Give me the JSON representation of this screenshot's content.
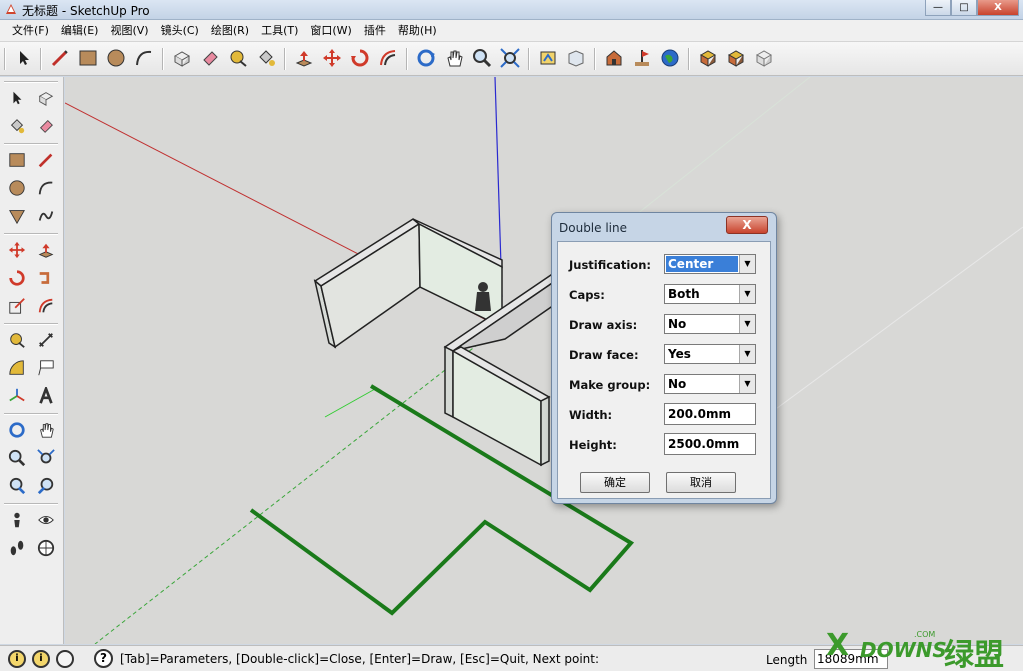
{
  "window": {
    "title": "无标题 - SketchUp Pro",
    "minimize": "—",
    "maximize": "□",
    "close": "X"
  },
  "menu": [
    "文件(F)",
    "编辑(E)",
    "视图(V)",
    "镜头(C)",
    "绘图(R)",
    "工具(T)",
    "窗口(W)",
    "插件",
    "帮助(H)"
  ],
  "dialog": {
    "title": "Double line",
    "close": "X",
    "justification_label": "Justification:",
    "justification_value": "Center",
    "caps_label": "Caps:",
    "caps_value": "Both",
    "draw_axis_label": "Draw axis:",
    "draw_axis_value": "No",
    "draw_face_label": "Draw face:",
    "draw_face_value": "Yes",
    "make_group_label": "Make group:",
    "make_group_value": "No",
    "width_label": "Width:",
    "width_value": "200.0mm",
    "height_label": "Height:",
    "height_value": "2500.0mm",
    "ok_label": "确定",
    "cancel_label": "取消",
    "dropdown_arrow": "▼"
  },
  "status": {
    "hint": "[Tab]=Parameters, [Double-click]=Close,  [Enter]=Draw,   [Esc]=Quit,   Next point:",
    "length_label": "Length",
    "length_value": "18089mm",
    "help_icon": "?",
    "geo_icon": "i"
  },
  "watermark": {
    "x": "X",
    "text": "DOWNS",
    "com": ".COM",
    "cn": "绿盟"
  },
  "colors": {
    "viewport_bg": "#d8d8d6",
    "red_axis": "#c03030",
    "green_axis": "#3aa63a",
    "blue_axis": "#2a2ad0",
    "green_path": "#1a7a1a",
    "wall_face": "#e0e8df"
  },
  "icons": [
    "select-icon",
    "line-icon",
    "rectangle-icon",
    "circle-icon",
    "arc-icon",
    "eraser-icon",
    "paint-icon",
    "push-pull-icon",
    "move-icon",
    "rotate-icon",
    "offset-icon",
    "orbit-icon",
    "pan-icon",
    "zoom-icon",
    "zoom-extents-icon",
    "component-icon",
    "section-icon",
    "warehouse-icon",
    "geolocation-icon"
  ]
}
